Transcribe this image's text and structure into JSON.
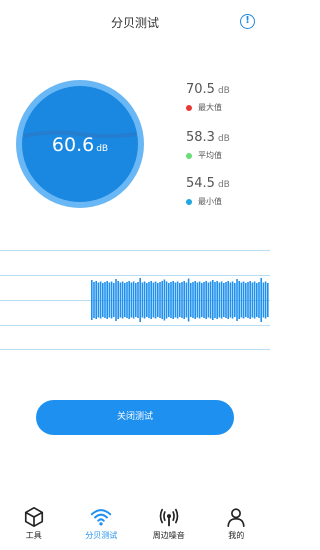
{
  "header": {
    "title": "分贝测试",
    "info_icon": "info-circle-icon",
    "info_glyph": "!"
  },
  "meter": {
    "value": "60.6",
    "unit": "dB",
    "level_fraction": 0.5
  },
  "stats": [
    {
      "value": "70.5",
      "unit": "dB",
      "label": "最大值",
      "color": "#e53935"
    },
    {
      "value": "58.3",
      "unit": "dB",
      "label": "平均值",
      "color": "#66dd77"
    },
    {
      "value": "54.5",
      "unit": "dB",
      "label": "最小值",
      "color": "#1ea7e0"
    }
  ],
  "action": {
    "label": "关闭测试"
  },
  "tabs": [
    {
      "label": "工具",
      "icon": "cube-icon",
      "active": false
    },
    {
      "label": "分贝测试",
      "icon": "wifi-icon",
      "active": true
    },
    {
      "label": "周边噪音",
      "icon": "signal-icon",
      "active": false
    },
    {
      "label": "我的",
      "icon": "user-icon",
      "active": false
    }
  ],
  "colors": {
    "accent": "#1e90f0",
    "meter_ring": "#6ab7f5",
    "meter_fill": "#1a88e0",
    "wave": "#1e90f0"
  }
}
